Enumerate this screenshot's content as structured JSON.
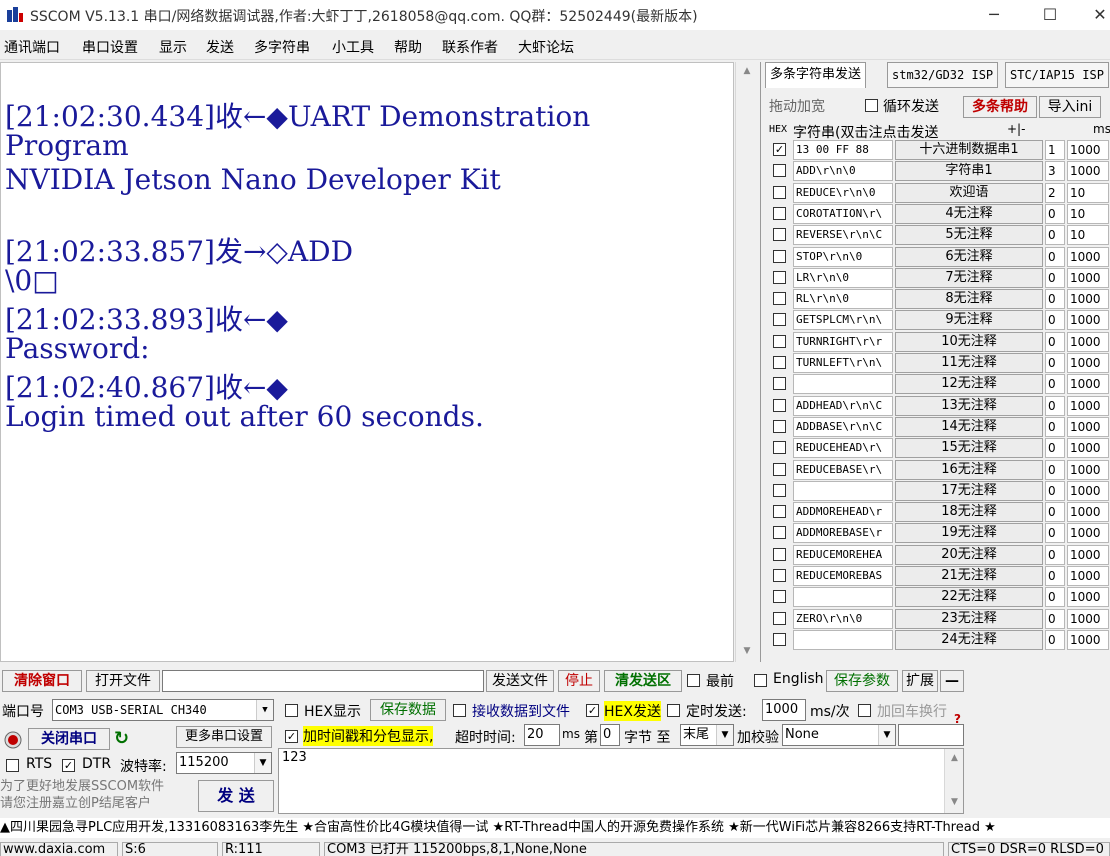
{
  "window": {
    "title": "SSCOM V5.13.1 串口/网络数据调试器,作者:大虾丁丁,2618058@qq.com. QQ群：52502449(最新版本)"
  },
  "menu": [
    "通讯端口",
    "串口设置",
    "显示",
    "发送",
    "多字符串",
    "小工具",
    "帮助",
    "联系作者",
    "大虾论坛"
  ],
  "receive": {
    "lines": [
      "[21:02:30.434]收←◆UART Demonstration",
      "Program",
      "NVIDIA Jetson Nano Developer Kit",
      "",
      "[21:02:33.857]发→◇ADD",
      "\\0□",
      "[21:02:33.893]收←◆",
      "Password:",
      "[21:02:40.867]收←◆",
      "Login timed out after 60 seconds."
    ]
  },
  "multi": {
    "tabs": [
      "多条字符串发送",
      "stm32/GD32 ISP",
      "STC/IAP15 ISP"
    ],
    "drag_label": "拖动加宽",
    "loop_label": "循环发送",
    "help_label": "多条帮助",
    "import_label": "导入ini",
    "header_hex": "HEX",
    "header_str": "字符串(双击注点击发送",
    "header_pm": "+|-",
    "header_ms": "ms",
    "rows": [
      {
        "checked": true,
        "text": "13 00 FF 88",
        "button": "十六进制数据串1",
        "n": "1",
        "ms": "1000"
      },
      {
        "checked": false,
        "text": "ADD\\r\\n\\0",
        "button": "字符串1",
        "n": "3",
        "ms": "1000"
      },
      {
        "checked": false,
        "text": "REDUCE\\r\\n\\0",
        "button": "欢迎语",
        "n": "2",
        "ms": "10"
      },
      {
        "checked": false,
        "text": "COROTATION\\r\\",
        "button": "4无注释",
        "n": "0",
        "ms": "10"
      },
      {
        "checked": false,
        "text": "REVERSE\\r\\n\\C",
        "button": "5无注释",
        "n": "0",
        "ms": "10"
      },
      {
        "checked": false,
        "text": "STOP\\r\\n\\0",
        "button": "6无注释",
        "n": "0",
        "ms": "1000"
      },
      {
        "checked": false,
        "text": "LR\\r\\n\\0",
        "button": "7无注释",
        "n": "0",
        "ms": "1000"
      },
      {
        "checked": false,
        "text": "RL\\r\\n\\0",
        "button": "8无注释",
        "n": "0",
        "ms": "1000"
      },
      {
        "checked": false,
        "text": "GETSPLCM\\r\\n\\",
        "button": "9无注释",
        "n": "0",
        "ms": "1000"
      },
      {
        "checked": false,
        "text": "TURNRIGHT\\r\\r",
        "button": "10无注释",
        "n": "0",
        "ms": "1000"
      },
      {
        "checked": false,
        "text": "TURNLEFT\\r\\n\\",
        "button": "11无注释",
        "n": "0",
        "ms": "1000"
      },
      {
        "checked": false,
        "text": "",
        "button": "12无注释",
        "n": "0",
        "ms": "1000"
      },
      {
        "checked": false,
        "text": "ADDHEAD\\r\\n\\C",
        "button": "13无注释",
        "n": "0",
        "ms": "1000"
      },
      {
        "checked": false,
        "text": "ADDBASE\\r\\n\\C",
        "button": "14无注释",
        "n": "0",
        "ms": "1000"
      },
      {
        "checked": false,
        "text": "REDUCEHEAD\\r\\",
        "button": "15无注释",
        "n": "0",
        "ms": "1000"
      },
      {
        "checked": false,
        "text": "REDUCEBASE\\r\\",
        "button": "16无注释",
        "n": "0",
        "ms": "1000"
      },
      {
        "checked": false,
        "text": "",
        "button": "17无注释",
        "n": "0",
        "ms": "1000"
      },
      {
        "checked": false,
        "text": "ADDMOREHEAD\\r",
        "button": "18无注释",
        "n": "0",
        "ms": "1000"
      },
      {
        "checked": false,
        "text": "ADDMOREBASE\\r",
        "button": "19无注释",
        "n": "0",
        "ms": "1000"
      },
      {
        "checked": false,
        "text": "REDUCEMOREHEA",
        "button": "20无注释",
        "n": "0",
        "ms": "1000"
      },
      {
        "checked": false,
        "text": "REDUCEMOREBAS",
        "button": "21无注释",
        "n": "0",
        "ms": "1000"
      },
      {
        "checked": false,
        "text": "",
        "button": "22无注释",
        "n": "0",
        "ms": "1000"
      },
      {
        "checked": false,
        "text": "ZERO\\r\\n\\0",
        "button": "23无注释",
        "n": "0",
        "ms": "1000"
      },
      {
        "checked": false,
        "text": "",
        "button": "24无注释",
        "n": "0",
        "ms": "1000"
      }
    ]
  },
  "toolbar": {
    "clear": "清除窗口",
    "open_file": "打开文件",
    "send_file": "发送文件",
    "stop": "停止",
    "clear_send": "清发送区",
    "top": "最前",
    "english": "English",
    "save_params": "保存参数",
    "expand": "扩展",
    "collapse": "—"
  },
  "port": {
    "label": "端口号",
    "value": "COM3 USB-SERIAL CH340",
    "close": "关闭串口",
    "more": "更多串口设置",
    "rts": "RTS",
    "dtr": "DTR",
    "baud_label": "波特率:",
    "baud": "115200",
    "promo": [
      "为了更好地发展SSCOM软件",
      "请您注册嘉立创P结尾客户"
    ]
  },
  "opts": {
    "hex_show": "HEX显示",
    "save_data": "保存数据",
    "recv_to_file": "接收数据到文件",
    "hex_send": "HEX发送",
    "timed_send": "定时发送:",
    "interval": "1000",
    "unit": "ms/次",
    "add_crlf": "加回车换行",
    "timestamp": "加时间戳和分包显示,",
    "timeout_label": "超时时间:",
    "timeout": "20",
    "timeout_unit": "ms",
    "byte_no": "第",
    "byte_val": "0",
    "byte_to": "字节 至",
    "end": "末尾",
    "checksum": "加校验",
    "checksum_val": "None",
    "send_text": "123",
    "send_btn": "发 送"
  },
  "ticker": "▲四川果园急寻PLC应用开发,13316083163李先生 ★合宙高性价比4G模块值得一试 ★RT-Thread中国人的开源免费操作系统 ★新一代WiFi芯片兼容8266支持RT-Thread ★",
  "status": {
    "site": "www.daxia.com",
    "s": "S:6",
    "r": "R:111",
    "port_state": "COM3 已打开 115200bps,8,1,None,None",
    "lines": "CTS=0 DSR=0 RLSD=0"
  },
  "colors": {
    "accent_red": "#c00000",
    "recv_text": "#1a1a9a",
    "highlight": "#ffff00",
    "green_text": "#007000"
  }
}
